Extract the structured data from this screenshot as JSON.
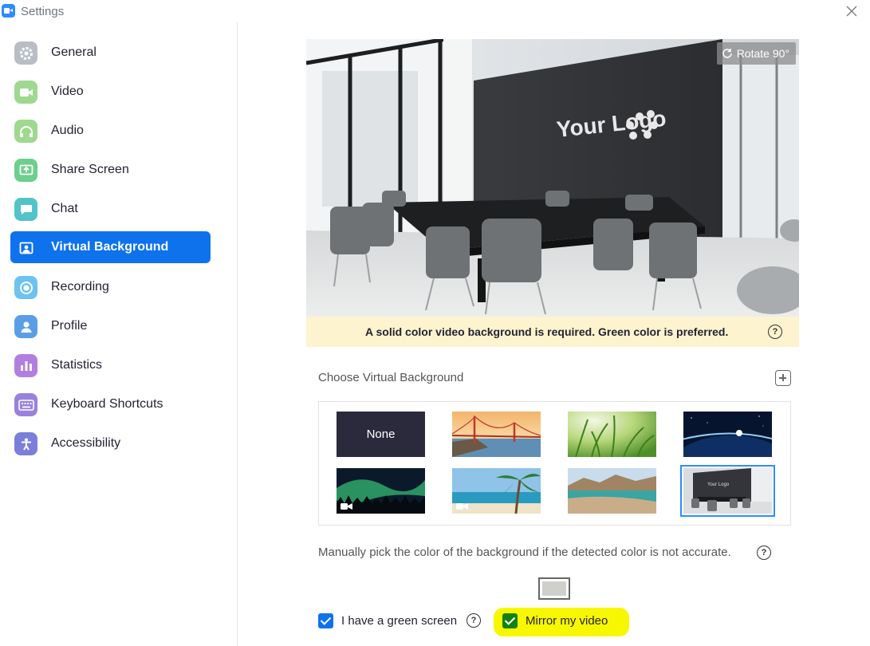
{
  "window": {
    "title": "Settings"
  },
  "colors": {
    "accent": "#0E72ED",
    "notice_bg": "#FDF3CE",
    "highlight": "#F7F700"
  },
  "sidebar": {
    "items": [
      {
        "label": "General",
        "icon": "gear-icon",
        "color": "#9aa0a6"
      },
      {
        "label": "Video",
        "icon": "video-camera-icon",
        "color": "#7bc96f"
      },
      {
        "label": "Audio",
        "icon": "headphones-icon",
        "color": "#7bc96f"
      },
      {
        "label": "Share Screen",
        "icon": "share-screen-icon",
        "color": "#4cbf7a"
      },
      {
        "label": "Chat",
        "icon": "chat-bubble-icon",
        "color": "#3cb3b8"
      },
      {
        "label": "Virtual Background",
        "icon": "virtual-background-icon",
        "color": "#0E72ED",
        "active": true
      },
      {
        "label": "Recording",
        "icon": "recording-icon",
        "color": "#4fb3f0"
      },
      {
        "label": "Profile",
        "icon": "profile-icon",
        "color": "#4a90e2"
      },
      {
        "label": "Statistics",
        "icon": "statistics-icon",
        "color": "#a071d9"
      },
      {
        "label": "Keyboard Shortcuts",
        "icon": "keyboard-icon",
        "color": "#8a6fd1"
      },
      {
        "label": "Accessibility",
        "icon": "accessibility-icon",
        "color": "#6c6fd1"
      }
    ]
  },
  "preview": {
    "rotate_label": "Rotate 90°",
    "logo_text": "Your Logo"
  },
  "notice": {
    "text": "A solid color video background is required. Green color is preferred."
  },
  "choose": {
    "label": "Choose Virtual Background"
  },
  "backgrounds": [
    {
      "label": "None",
      "kind": "none"
    },
    {
      "label": "",
      "kind": "golden-gate"
    },
    {
      "label": "",
      "kind": "grass"
    },
    {
      "label": "",
      "kind": "earth"
    },
    {
      "label": "",
      "kind": "aurora",
      "video": true
    },
    {
      "label": "",
      "kind": "beach-palm",
      "video": true
    },
    {
      "label": "",
      "kind": "lake",
      "video": false
    },
    {
      "label": "",
      "kind": "office",
      "selected": true
    }
  ],
  "manual": {
    "text": "Manually pick the color of the background if the detected color is not accurate."
  },
  "options": {
    "green_screen": {
      "label": "I have a green screen",
      "checked": true
    },
    "mirror": {
      "label": "Mirror my video",
      "checked": true
    }
  }
}
